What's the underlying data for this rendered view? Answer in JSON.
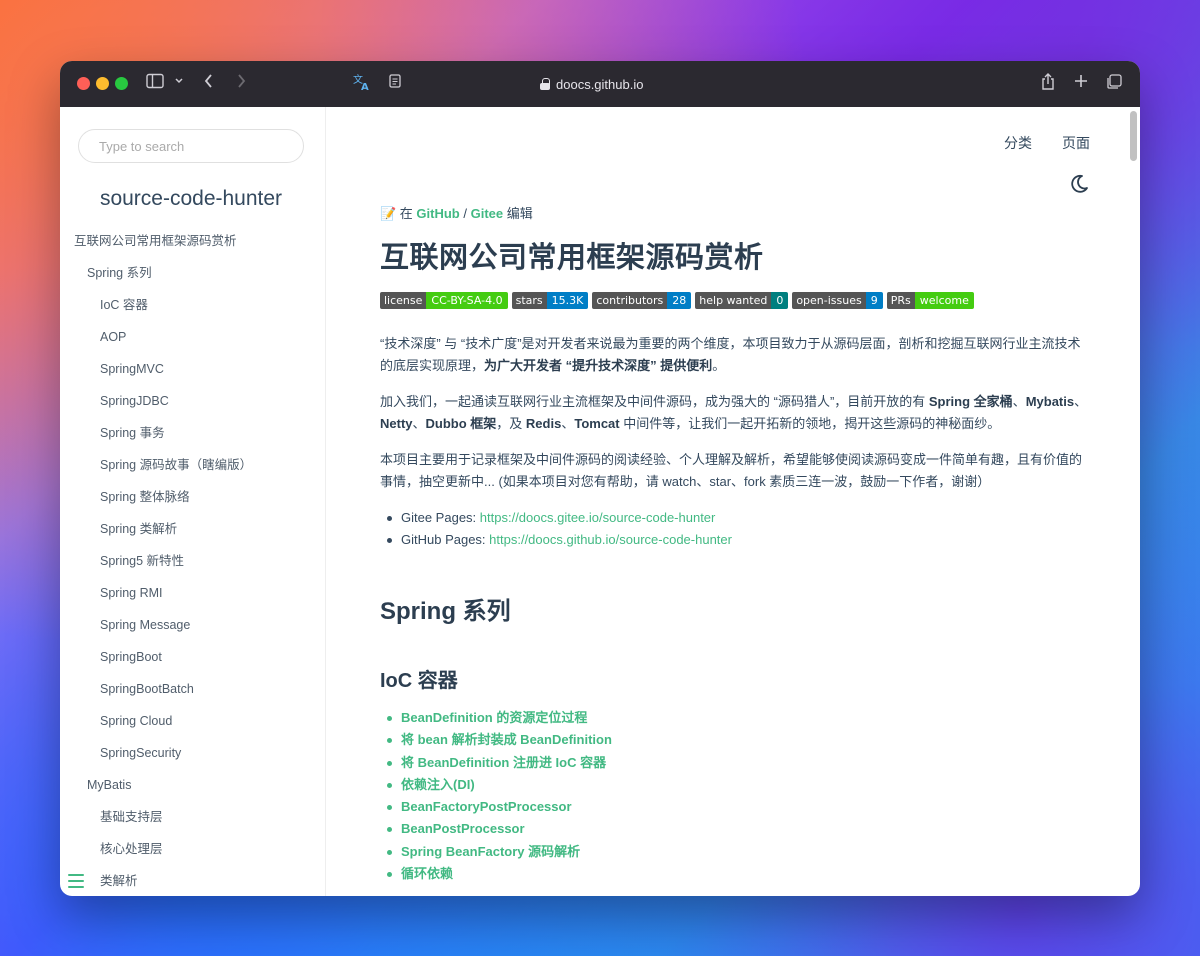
{
  "browser": {
    "url": "doocs.github.io"
  },
  "sidebar": {
    "search_placeholder": "Type to search",
    "app_name": "source-code-hunter",
    "items": [
      {
        "label": "互联网公司常用框架源码赏析",
        "level": 0
      },
      {
        "label": "Spring 系列",
        "level": 1
      },
      {
        "label": "IoC 容器",
        "level": 2
      },
      {
        "label": "AOP",
        "level": 2
      },
      {
        "label": "SpringMVC",
        "level": 2
      },
      {
        "label": "SpringJDBC",
        "level": 2
      },
      {
        "label": "Spring 事务",
        "level": 2
      },
      {
        "label": "Spring 源码故事（瞎编版）",
        "level": 2
      },
      {
        "label": "Spring 整体脉络",
        "level": 2
      },
      {
        "label": "Spring 类解析",
        "level": 2
      },
      {
        "label": "Spring5 新特性",
        "level": 2
      },
      {
        "label": "Spring RMI",
        "level": 2
      },
      {
        "label": "Spring Message",
        "level": 2
      },
      {
        "label": "SpringBoot",
        "level": 2
      },
      {
        "label": "SpringBootBatch",
        "level": 2
      },
      {
        "label": "Spring Cloud",
        "level": 2
      },
      {
        "label": "SpringSecurity",
        "level": 2
      },
      {
        "label": "MyBatis",
        "level": 1
      },
      {
        "label": "基础支持层",
        "level": 2
      },
      {
        "label": "核心处理层",
        "level": 2
      },
      {
        "label": "类解析",
        "level": 2
      }
    ]
  },
  "topnav": {
    "categories": "分类",
    "pages": "页面"
  },
  "article": {
    "edit_prefix": "📝 在 ",
    "edit_github": "GitHub",
    "edit_sep": " / ",
    "edit_gitee": "Gitee",
    "edit_suffix": " 编辑",
    "title": "互联网公司常用框架源码赏析",
    "badges": [
      {
        "key": "license",
        "value": "CC-BY-SA-4.0",
        "color": "#4c1"
      },
      {
        "key": "stars",
        "value": "15.3K",
        "color": "#007ec6"
      },
      {
        "key": "contributors",
        "value": "28",
        "color": "#007ec6"
      },
      {
        "key": "help wanted",
        "value": "0",
        "color": "#007f7f"
      },
      {
        "key": "open-issues",
        "value": "9",
        "color": "#007ec6"
      },
      {
        "key": "PRs",
        "value": "welcome",
        "color": "#4c1"
      }
    ],
    "p1_text": "“技术深度” 与 “技术广度”是对开发者来说最为重要的两个维度，本项目致力于从源码层面，剖析和挖掘互联网行业主流技术的底层实现原理，",
    "p1_bold": "为广大开发者 “提升技术深度” 提供便利",
    "p1_end": "。",
    "p2_a": "加入我们，一起通读互联网行业主流框架及中间件源码，成为强大的 “源码猎人”，目前开放的有 ",
    "p2_b1": "Spring 全家桶",
    "p2_c": "、",
    "p2_b2": "Mybatis",
    "p2_d": "、",
    "p2_b3": "Netty",
    "p2_e": "、",
    "p2_b4": "Dubbo 框架",
    "p2_f": "，及 ",
    "p2_b5": "Redis",
    "p2_g": "、",
    "p2_b6": "Tomcat",
    "p2_h": " 中间件等，让我们一起开拓新的领地，揭开这些源码的神秘面纱。",
    "p3": "本项目主要用于记录框架及中间件源码的阅读经验、个人理解及解析，希望能够使阅读源码变成一件简单有趣，且有价值的事情，抽空更新中... (如果本项目对您有帮助，请 watch、star、fork 素质三连一波，鼓励一下作者，谢谢）",
    "links": [
      {
        "label": "Gitee Pages: ",
        "url": "https://doocs.gitee.io/source-code-hunter"
      },
      {
        "label": "GitHub Pages: ",
        "url": "https://doocs.github.io/source-code-hunter"
      }
    ],
    "section_title": "Spring 系列",
    "subsection_title": "IoC 容器",
    "topics": [
      "BeanDefinition 的资源定位过程",
      "将 bean 解析封装成 BeanDefinition",
      "将 BeanDefinition 注册进 IoC 容器",
      "依赖注入(DI)",
      "BeanFactoryPostProcessor",
      "BeanPostProcessor",
      "Spring BeanFactory 源码解析",
      "循环依赖"
    ]
  }
}
